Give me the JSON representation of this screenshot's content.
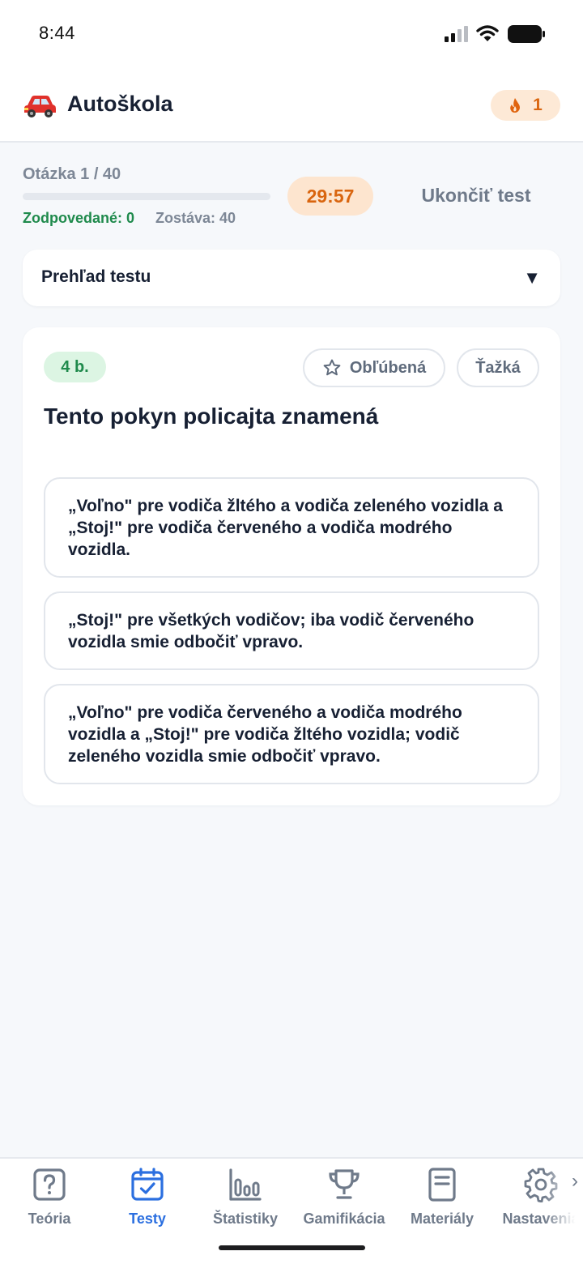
{
  "status_bar": {
    "time": "8:44"
  },
  "header": {
    "title": "Autoškola",
    "streak_count": "1",
    "logo_icon": "car-icon",
    "streak_icon": "flame-icon"
  },
  "progress": {
    "counter": "Otázka 1 / 40",
    "fraction": 0,
    "answered": "Zodpovedané: 0",
    "remaining": "Zostáva: 40",
    "timer": "29:57",
    "end_label": "Ukončiť test"
  },
  "overview": {
    "label": "Prehľad testu",
    "caret": "▼"
  },
  "question": {
    "points": "4 b.",
    "favorite_label": "Obľúbená",
    "hard_label": "Ťažká",
    "text": "Tento pokyn policajta znamená",
    "answers": [
      "„Voľno\" pre vodiča žltého a vodiča zeleného vozidla a „Stoj!\" pre vodiča červeného a vodiča modrého vozidla.",
      "„Stoj!\" pre všetkých vodičov; iba vodič červeného vozidla smie odbočiť vpravo.",
      "„Voľno\" pre vodiča červeného a vodiča modrého vozidla a „Stoj!\" pre vodiča žltého vozidla; vodič zeleného vozidla smie odbočiť vpravo."
    ]
  },
  "nav": {
    "items": [
      {
        "label": "Teória",
        "icon": "question-icon"
      },
      {
        "label": "Testy",
        "icon": "calendar-check-icon"
      },
      {
        "label": "Štatistiky",
        "icon": "bar-chart-icon"
      },
      {
        "label": "Gamifikácia",
        "icon": "trophy-icon"
      },
      {
        "label": "Materiály",
        "icon": "document-icon"
      },
      {
        "label": "Nastavenia",
        "icon": "gear-icon"
      }
    ],
    "more": "›"
  },
  "colors": {
    "accent": "#2b6fe0",
    "orange": "#d9650f",
    "green": "#1f8a4c"
  }
}
